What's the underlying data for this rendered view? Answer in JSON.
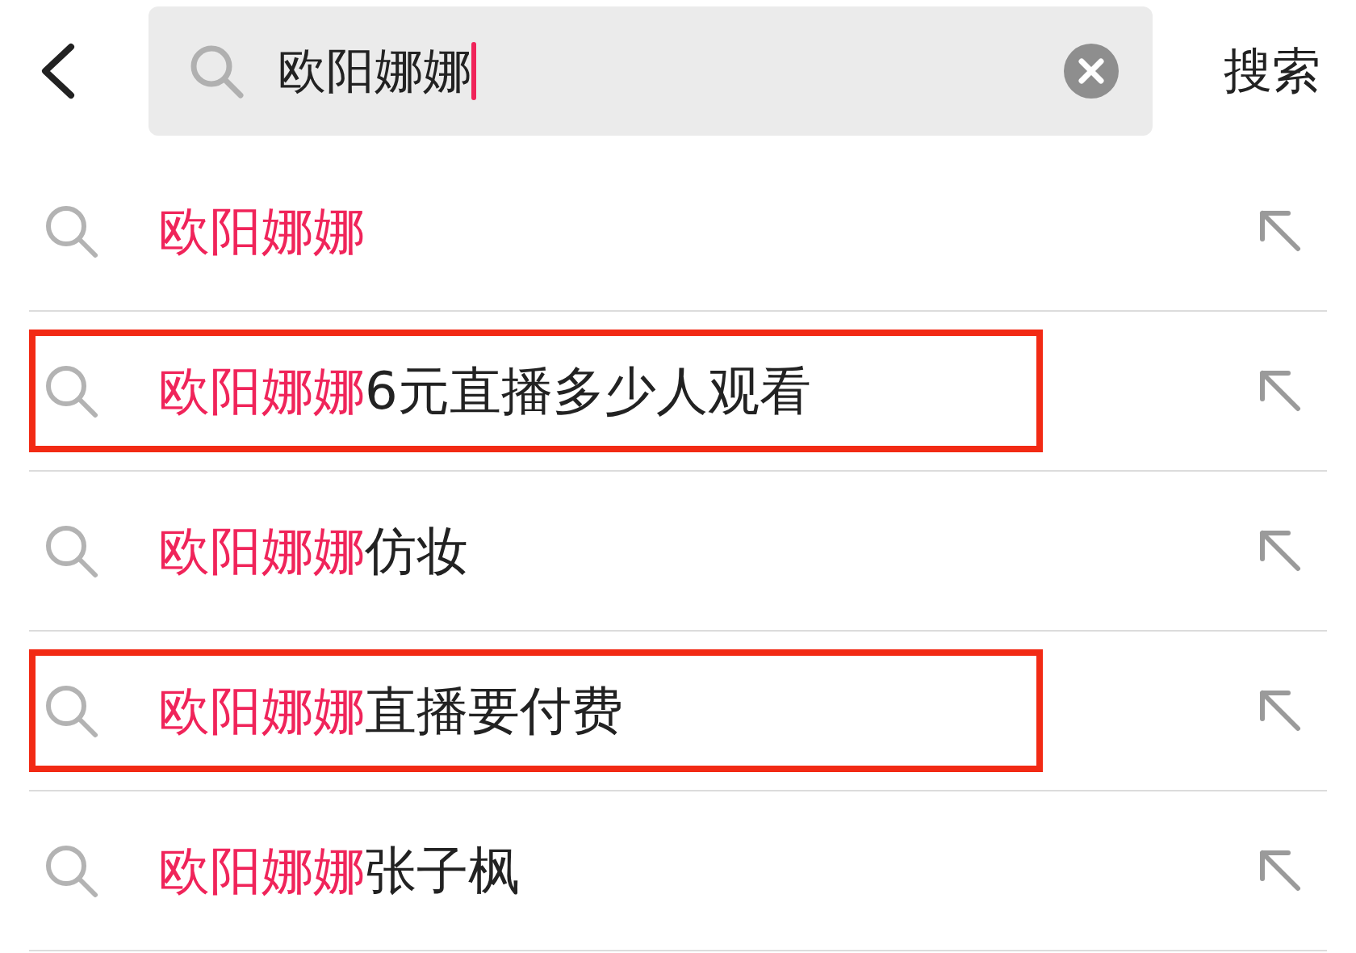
{
  "search": {
    "value": "欧阳娜娜",
    "action": "搜索"
  },
  "suggestions": [
    {
      "match": "欧阳娜娜",
      "outlined": false
    },
    {
      "match": "欧阳娜娜",
      "rest": "6元直播多少人观看",
      "outlined": true
    },
    {
      "match": "欧阳娜娜",
      "rest": "仿妆",
      "outlined": false
    },
    {
      "match": "欧阳娜娜",
      "rest": "直播要付费",
      "outlined": true
    },
    {
      "match": "欧阳娜娜",
      "rest": "张子枫",
      "outlined": false
    }
  ]
}
